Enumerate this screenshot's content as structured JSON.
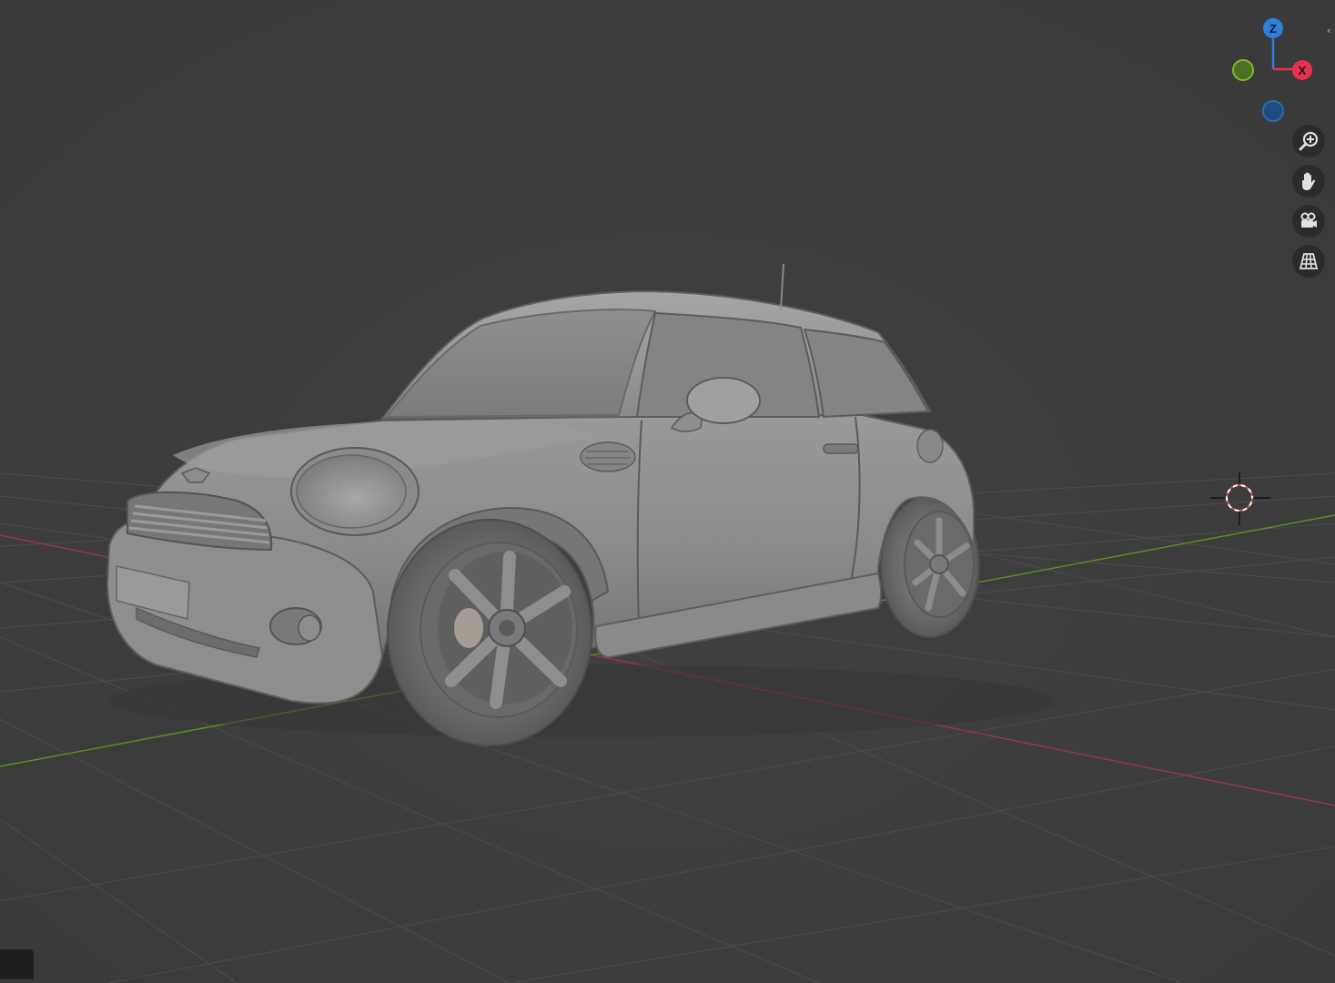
{
  "viewport": {
    "background": "#3d3d3d",
    "grid_color": "#4a4a4a",
    "x_axis_color": "#b03a48",
    "y_axis_color": "#6a9a2a",
    "object": "car-model"
  },
  "gizmo": {
    "z_label": "Z",
    "x_label": "X",
    "z_color": "#2f7fdc",
    "x_color": "#e8304e",
    "y_color": "#6e9d2a"
  },
  "nav_buttons": [
    {
      "name": "zoom-icon"
    },
    {
      "name": "pan-hand-icon"
    },
    {
      "name": "camera-icon"
    },
    {
      "name": "ortho-grid-icon"
    }
  ],
  "sidebar_toggle": "‹"
}
